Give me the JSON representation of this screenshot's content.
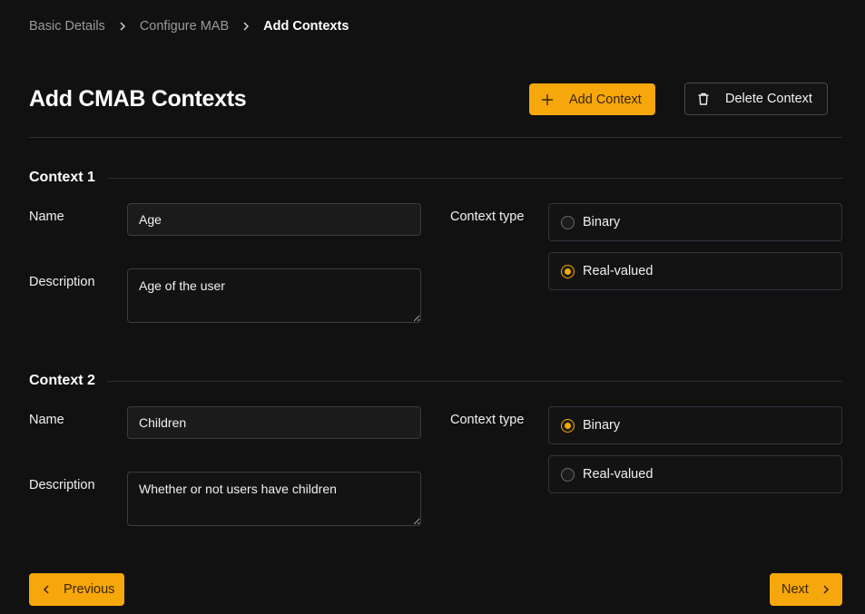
{
  "breadcrumb": {
    "items": [
      "Basic Details",
      "Configure MAB",
      "Add Contexts"
    ]
  },
  "header": {
    "title": "Add CMAB Contexts",
    "add_context_label": "Add Context",
    "delete_context_label": "Delete Context"
  },
  "contexts": [
    {
      "title": "Context 1",
      "name_label": "Name",
      "name_value": "Age",
      "description_label": "Description",
      "description_value": "Age of the user",
      "type_label": "Context type",
      "options": [
        "Binary",
        "Real-valued"
      ],
      "selected": "Real-valued"
    },
    {
      "title": "Context 2",
      "name_label": "Name",
      "name_value": "Children",
      "description_label": "Description",
      "description_value": "Whether or not users have children",
      "type_label": "Context type",
      "options": [
        "Binary",
        "Real-valued"
      ],
      "selected": "Binary"
    }
  ],
  "footer": {
    "previous_label": "Previous",
    "next_label": "Next"
  },
  "colors": {
    "background": "#111111",
    "accent": "#f5a70b",
    "border": "#3c3c3c"
  },
  "icons": [
    "chevron-right-icon",
    "plus-icon",
    "trash-icon",
    "chevron-left-icon"
  ]
}
